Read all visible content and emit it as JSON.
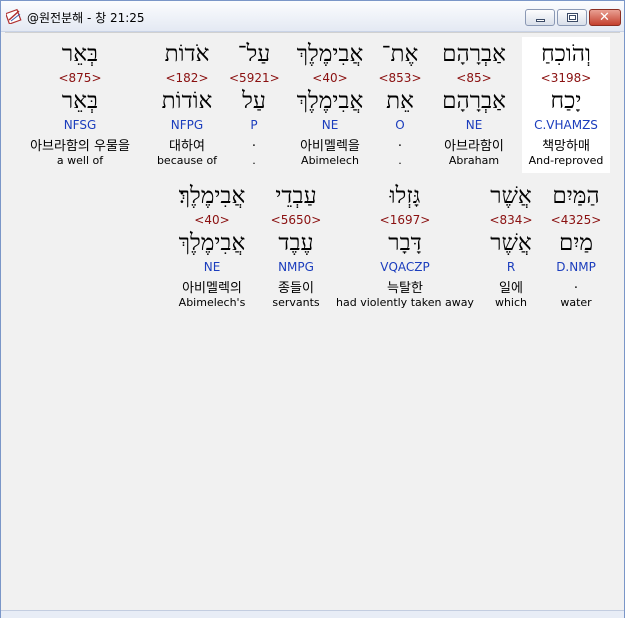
{
  "window": {
    "title": "@원전분해 - 창 21:25",
    "close_glyph": "✕"
  },
  "rows": [
    [
      {
        "hebrew": "וְהֹוכִחַ",
        "number": "<3198>",
        "lemma": "יָכַח",
        "parse": "C.VHAMZS",
        "korean": "책망하매",
        "english": "And-reproved",
        "selected": true
      },
      {
        "hebrew": "אַבְרָהָם",
        "number": "<85>",
        "lemma": "אַבְרָהָם",
        "parse": "NE",
        "korean": "아브라함이",
        "english": "Abraham"
      },
      {
        "hebrew": "אֶת־",
        "number": "<853>",
        "lemma": "אֵת",
        "parse": "O",
        "korean": ".",
        "english": "."
      },
      {
        "hebrew": "אֲבִימֶלֶךְ",
        "number": "<40>",
        "lemma": "אֲבִימֶלֶךְ",
        "parse": "NE",
        "korean": "아비멜렉을",
        "english": "Abimelech"
      },
      {
        "hebrew": "עַל־",
        "number": "<5921>",
        "lemma": "עַל",
        "parse": "P",
        "korean": ".",
        "english": "."
      },
      {
        "hebrew": "אֹדוֹת",
        "number": "<182>",
        "lemma": "אוֹדוֹת",
        "parse": "NFPG",
        "korean": "대하여",
        "english": "because of"
      },
      {
        "hebrew": "בְּאֵר",
        "number": "<875>",
        "lemma": "בְּאֵר",
        "parse": "NFSG",
        "korean": "아브라함의 우물을",
        "english": "a well of"
      }
    ],
    [
      {
        "hebrew": "הַמַּיִם",
        "number": "<4325>",
        "lemma": "מַיִם",
        "parse": "D.NMP",
        "korean": ".",
        "english": "water"
      },
      {
        "hebrew": "אֲשֶׁר",
        "number": "<834>",
        "lemma": "אֲשֶׁר",
        "parse": "R",
        "korean": "일에",
        "english": "which"
      },
      {
        "hebrew": "גָּזְלוּ",
        "number": "<1697>",
        "lemma": "דָּבָר",
        "parse": "VQACZP",
        "korean": "늑탈한",
        "english": "had violently taken away"
      },
      {
        "hebrew": "עַבְדֵי",
        "number": "<5650>",
        "lemma": "עֶבֶד",
        "parse": "NMPG",
        "korean": "종들이",
        "english": "servants"
      },
      {
        "hebrew": "אֲבִימֶלֶךְ׃",
        "number": "<40>",
        "lemma": "אֲבִימֶלֶךְ",
        "parse": "NE",
        "korean": "아비멜렉의",
        "english": "Abimelech's"
      }
    ]
  ]
}
